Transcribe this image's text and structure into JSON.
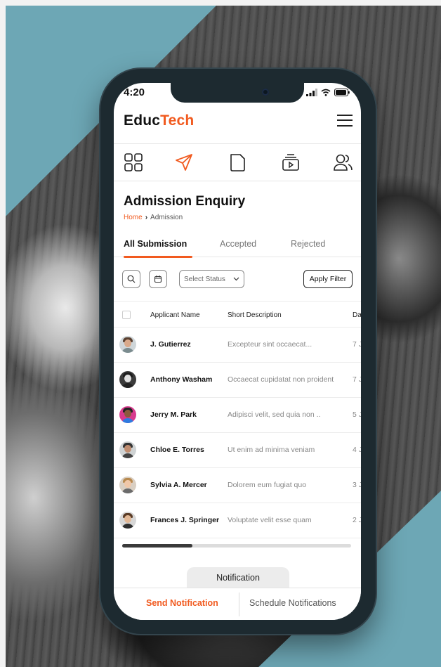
{
  "status": {
    "time": "4:20"
  },
  "brand": {
    "part1": "Educ",
    "part2": "Tech"
  },
  "page": {
    "title": "Admission Enquiry"
  },
  "breadcrumb": {
    "home": "Home",
    "separator": "›",
    "current": "Admission"
  },
  "tabs": [
    {
      "label": "All Submission"
    },
    {
      "label": "Accepted"
    },
    {
      "label": "Rejected"
    }
  ],
  "filters": {
    "select_status": "Select Status",
    "apply": "Apply Filter"
  },
  "table": {
    "columns": [
      "Applicant Name",
      "Short Description",
      "Da"
    ],
    "rows": [
      {
        "name": "J. Gutierrez",
        "desc": "Excepteur sint occaecat...",
        "date": "7 J"
      },
      {
        "name": "Anthony Washam",
        "desc": "Occaecat cupidatat non proident",
        "date": "7 J"
      },
      {
        "name": "Jerry M. Park",
        "desc": "Adipisci velit, sed quia non ..",
        "date": "5 J"
      },
      {
        "name": "Chloe E. Torres",
        "desc": "Ut enim ad minima veniam",
        "date": "4 J"
      },
      {
        "name": "Sylvia A. Mercer",
        "desc": "Dolorem eum fugiat quo",
        "date": "3 J"
      },
      {
        "name": "Frances J. Springer",
        "desc": "Voluptate velit esse quam",
        "date": "2 J"
      }
    ]
  },
  "footer": {
    "notification_tab": "Notification",
    "send": "Send Notification",
    "schedule": "Schedule Notifications"
  },
  "colors": {
    "accent": "#f15a1f",
    "background_teal": "#6da7b5"
  }
}
